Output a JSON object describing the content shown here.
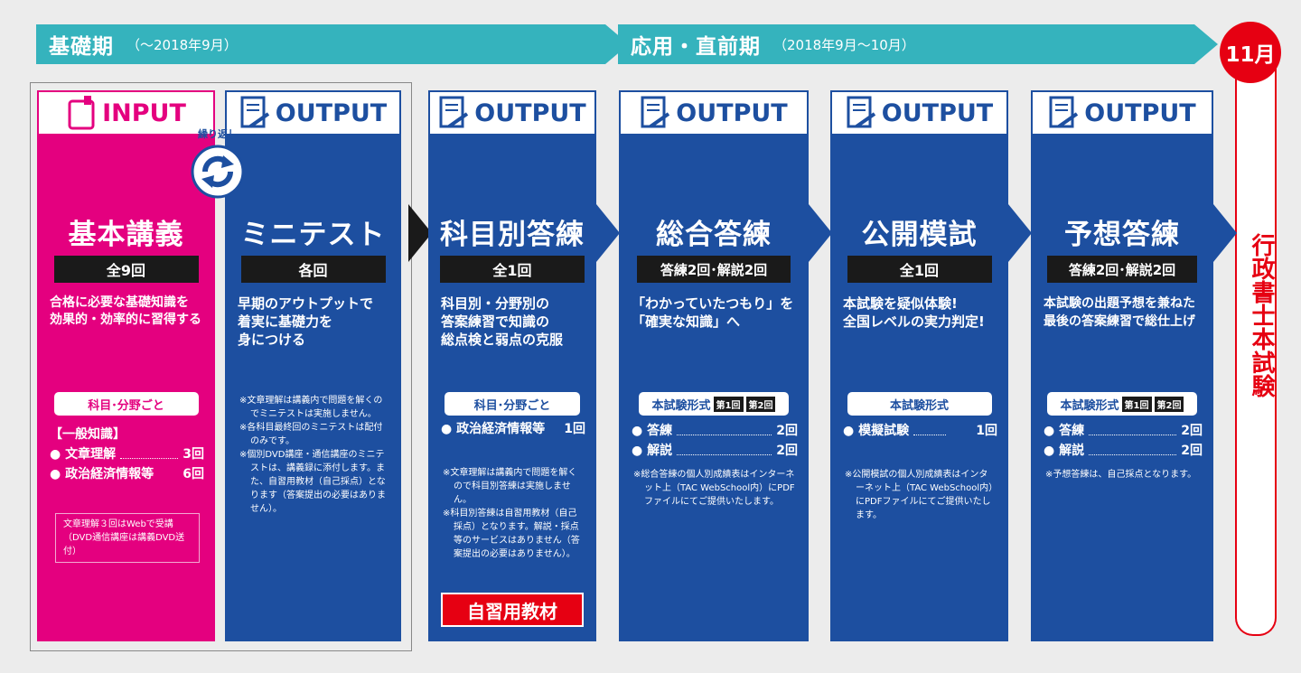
{
  "phases": [
    {
      "title": "基礎期",
      "sub": "（〜2018年9月）"
    },
    {
      "title": "応用・直前期",
      "sub": "（2018年9月〜10月）"
    }
  ],
  "month": "11月",
  "exam": "行政書士本試験",
  "repeat_label": "繰り返し",
  "columns": [
    {
      "header": "INPUT",
      "title": "基本講義",
      "badge": "全9回",
      "desc": [
        "合格に必要な基礎知識を",
        "効果的・効率的に習得する"
      ],
      "pill": "科目･分野ごと",
      "subhead": "【一般知識】",
      "items": [
        {
          "label": "文章理解",
          "count": "3回"
        },
        {
          "label": "政治経済情報等",
          "count": "6回"
        }
      ],
      "note": "文章理解３回はWebで受講（DVD通信講座は講義DVD送付）"
    },
    {
      "header": "OUTPUT",
      "title": "ミニテスト",
      "badge": "各回",
      "desc": [
        "早期のアウトプットで",
        "着実に基礎力を",
        "身につける"
      ],
      "notes": [
        "※文章理解は講義内で問題を解くのでミニテストは実施しません。",
        "※各科目最終回のミニテストは配付のみです。",
        "※個別DVD講座・通信講座のミニテストは、講義録に添付します。また、自習用教材（自己採点）となります（答案提出の必要はありません）。"
      ]
    },
    {
      "header": "OUTPUT",
      "title": "科目別答練",
      "badge": "全1回",
      "desc": [
        "科目別・分野別の",
        "答案練習で知識の",
        "総点検と弱点の克服"
      ],
      "pill": "科目･分野ごと",
      "items": [
        {
          "label": "政治経済情報等",
          "count": "1回"
        }
      ],
      "notes": [
        "※文章理解は講義内で問題を解くので科目別答練は実施しません。",
        "※科目別答練は自習用教材（自己採点）となります。解説・採点等のサービスはありません（答案提出の必要はありません）。"
      ],
      "self_study": "自習用教材"
    },
    {
      "header": "OUTPUT",
      "title": "総合答練",
      "badge": "答練2回･解説2回",
      "desc": [
        "「わかっていたつもり」を",
        "「確実な知識」へ"
      ],
      "pill": "本試験形式",
      "tags": [
        "第1回",
        "第2回"
      ],
      "items": [
        {
          "label": "答練",
          "count": "2回"
        },
        {
          "label": "解説",
          "count": "2回"
        }
      ],
      "notes": [
        "※総合答練の個人別成績表はインターネット上（TAC WebSchool内）にPDFファイルにてご提供いたします。"
      ]
    },
    {
      "header": "OUTPUT",
      "title": "公開模試",
      "badge": "全1回",
      "desc": [
        "本試験を疑似体験!",
        "全国レベルの実力判定!"
      ],
      "pill": "本試験形式",
      "items": [
        {
          "label": "模擬試験",
          "count": "1回"
        }
      ],
      "notes": [
        "※公開模試の個人別成績表はインターネット上（TAC WebSchool内）にPDFファイルにてご提供いたします。"
      ]
    },
    {
      "header": "OUTPUT",
      "title": "予想答練",
      "badge": "答練2回･解説2回",
      "desc": [
        "本試験の出題予想を兼ねた",
        "最後の答案練習で総仕上げ"
      ],
      "pill": "本試験形式",
      "tags": [
        "第1回",
        "第2回"
      ],
      "items": [
        {
          "label": "答練",
          "count": "2回"
        },
        {
          "label": "解説",
          "count": "2回"
        }
      ],
      "notes": [
        "※予想答練は、自己採点となります。"
      ]
    }
  ],
  "colors": {
    "blue": "#1d4fa0",
    "pink": "#e4007f",
    "teal": "#35b3bd",
    "red": "#e60012"
  }
}
